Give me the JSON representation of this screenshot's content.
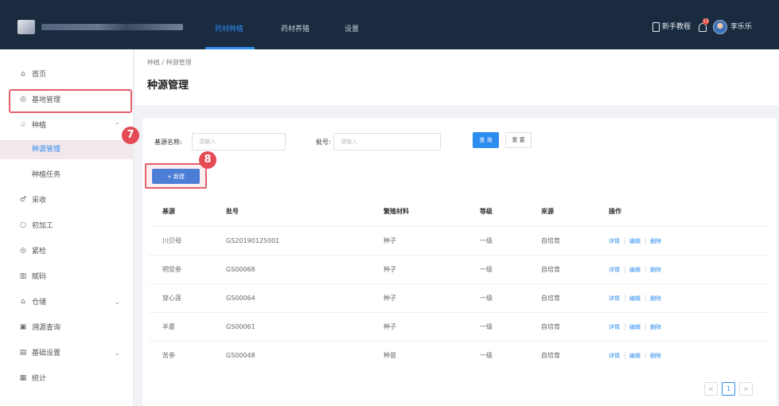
{
  "topbar": {
    "tabs": [
      {
        "label": "药材种植",
        "active": true
      },
      {
        "label": "药材养殖",
        "active": false
      },
      {
        "label": "设置",
        "active": false
      }
    ],
    "tutorial_label": "新手教程",
    "notification_count": "13",
    "username": "李乐乐"
  },
  "sidebar": {
    "items": [
      {
        "icon": "home-icon",
        "glyph": "⌂",
        "label": "首页"
      },
      {
        "icon": "base-icon",
        "glyph": "◎",
        "label": "基地管理"
      },
      {
        "icon": "seedling-icon",
        "glyph": "♧",
        "label": "种植",
        "expanded": true
      },
      {
        "icon": "harvest-icon",
        "glyph": "♂",
        "label": "采收"
      },
      {
        "icon": "process-icon",
        "glyph": "○",
        "label": "初加工"
      },
      {
        "icon": "inspect-icon",
        "glyph": "◎",
        "label": "紧检"
      },
      {
        "icon": "barcode-icon",
        "glyph": "▥",
        "label": "赋码"
      },
      {
        "icon": "warehouse-icon",
        "glyph": "⌂",
        "label": "仓储",
        "has_children": true
      },
      {
        "icon": "trace-icon",
        "glyph": "▣",
        "label": "溯源查询"
      },
      {
        "icon": "settings-icon",
        "glyph": "▤",
        "label": "基础设置",
        "has_children": true
      },
      {
        "icon": "stats-icon",
        "glyph": "▦",
        "label": "统计"
      }
    ],
    "sub_items": [
      {
        "label": "种源管理",
        "active": true
      },
      {
        "label": "种植任务",
        "active": false
      }
    ]
  },
  "header": {
    "breadcrumb": "种植 / 种源管理",
    "title": "种源管理"
  },
  "filters": {
    "base_name_label": "基源名称:",
    "base_name_placeholder": "请输入",
    "batch_label": "批号:",
    "batch_placeholder": "请输入",
    "query_label": "查 询",
    "reset_label": "重 置"
  },
  "actions": {
    "new_label": "+ 新建"
  },
  "annotations": {
    "step_7": "7",
    "step_8": "8"
  },
  "table": {
    "columns": [
      "基源",
      "批号",
      "繁殖材料",
      "等级",
      "来源",
      "操作"
    ],
    "rows": [
      {
        "source": "川贝母",
        "batch": "GS20190125001",
        "material": "种子",
        "grade": "一级",
        "origin": "自培育"
      },
      {
        "source": "明党参",
        "batch": "GS00068",
        "material": "种子",
        "grade": "一级",
        "origin": "自培育"
      },
      {
        "source": "穿心莲",
        "batch": "GS00064",
        "material": "种子",
        "grade": "一级",
        "origin": "自培育"
      },
      {
        "source": "半夏",
        "batch": "GS00061",
        "material": "种子",
        "grade": "一级",
        "origin": "自培育"
      },
      {
        "source": "苦参",
        "batch": "GS00048",
        "material": "种苗",
        "grade": "一级",
        "origin": "自培育"
      }
    ],
    "op_labels": {
      "detail": "详情",
      "edit": "编辑",
      "delete": "删除"
    }
  },
  "pagination": {
    "prev": "<",
    "current": "1",
    "next": ">"
  },
  "colors": {
    "topbar_bg": "#1a2a3f",
    "accent": "#2d8cf0",
    "highlight_red": "#e4606a"
  }
}
